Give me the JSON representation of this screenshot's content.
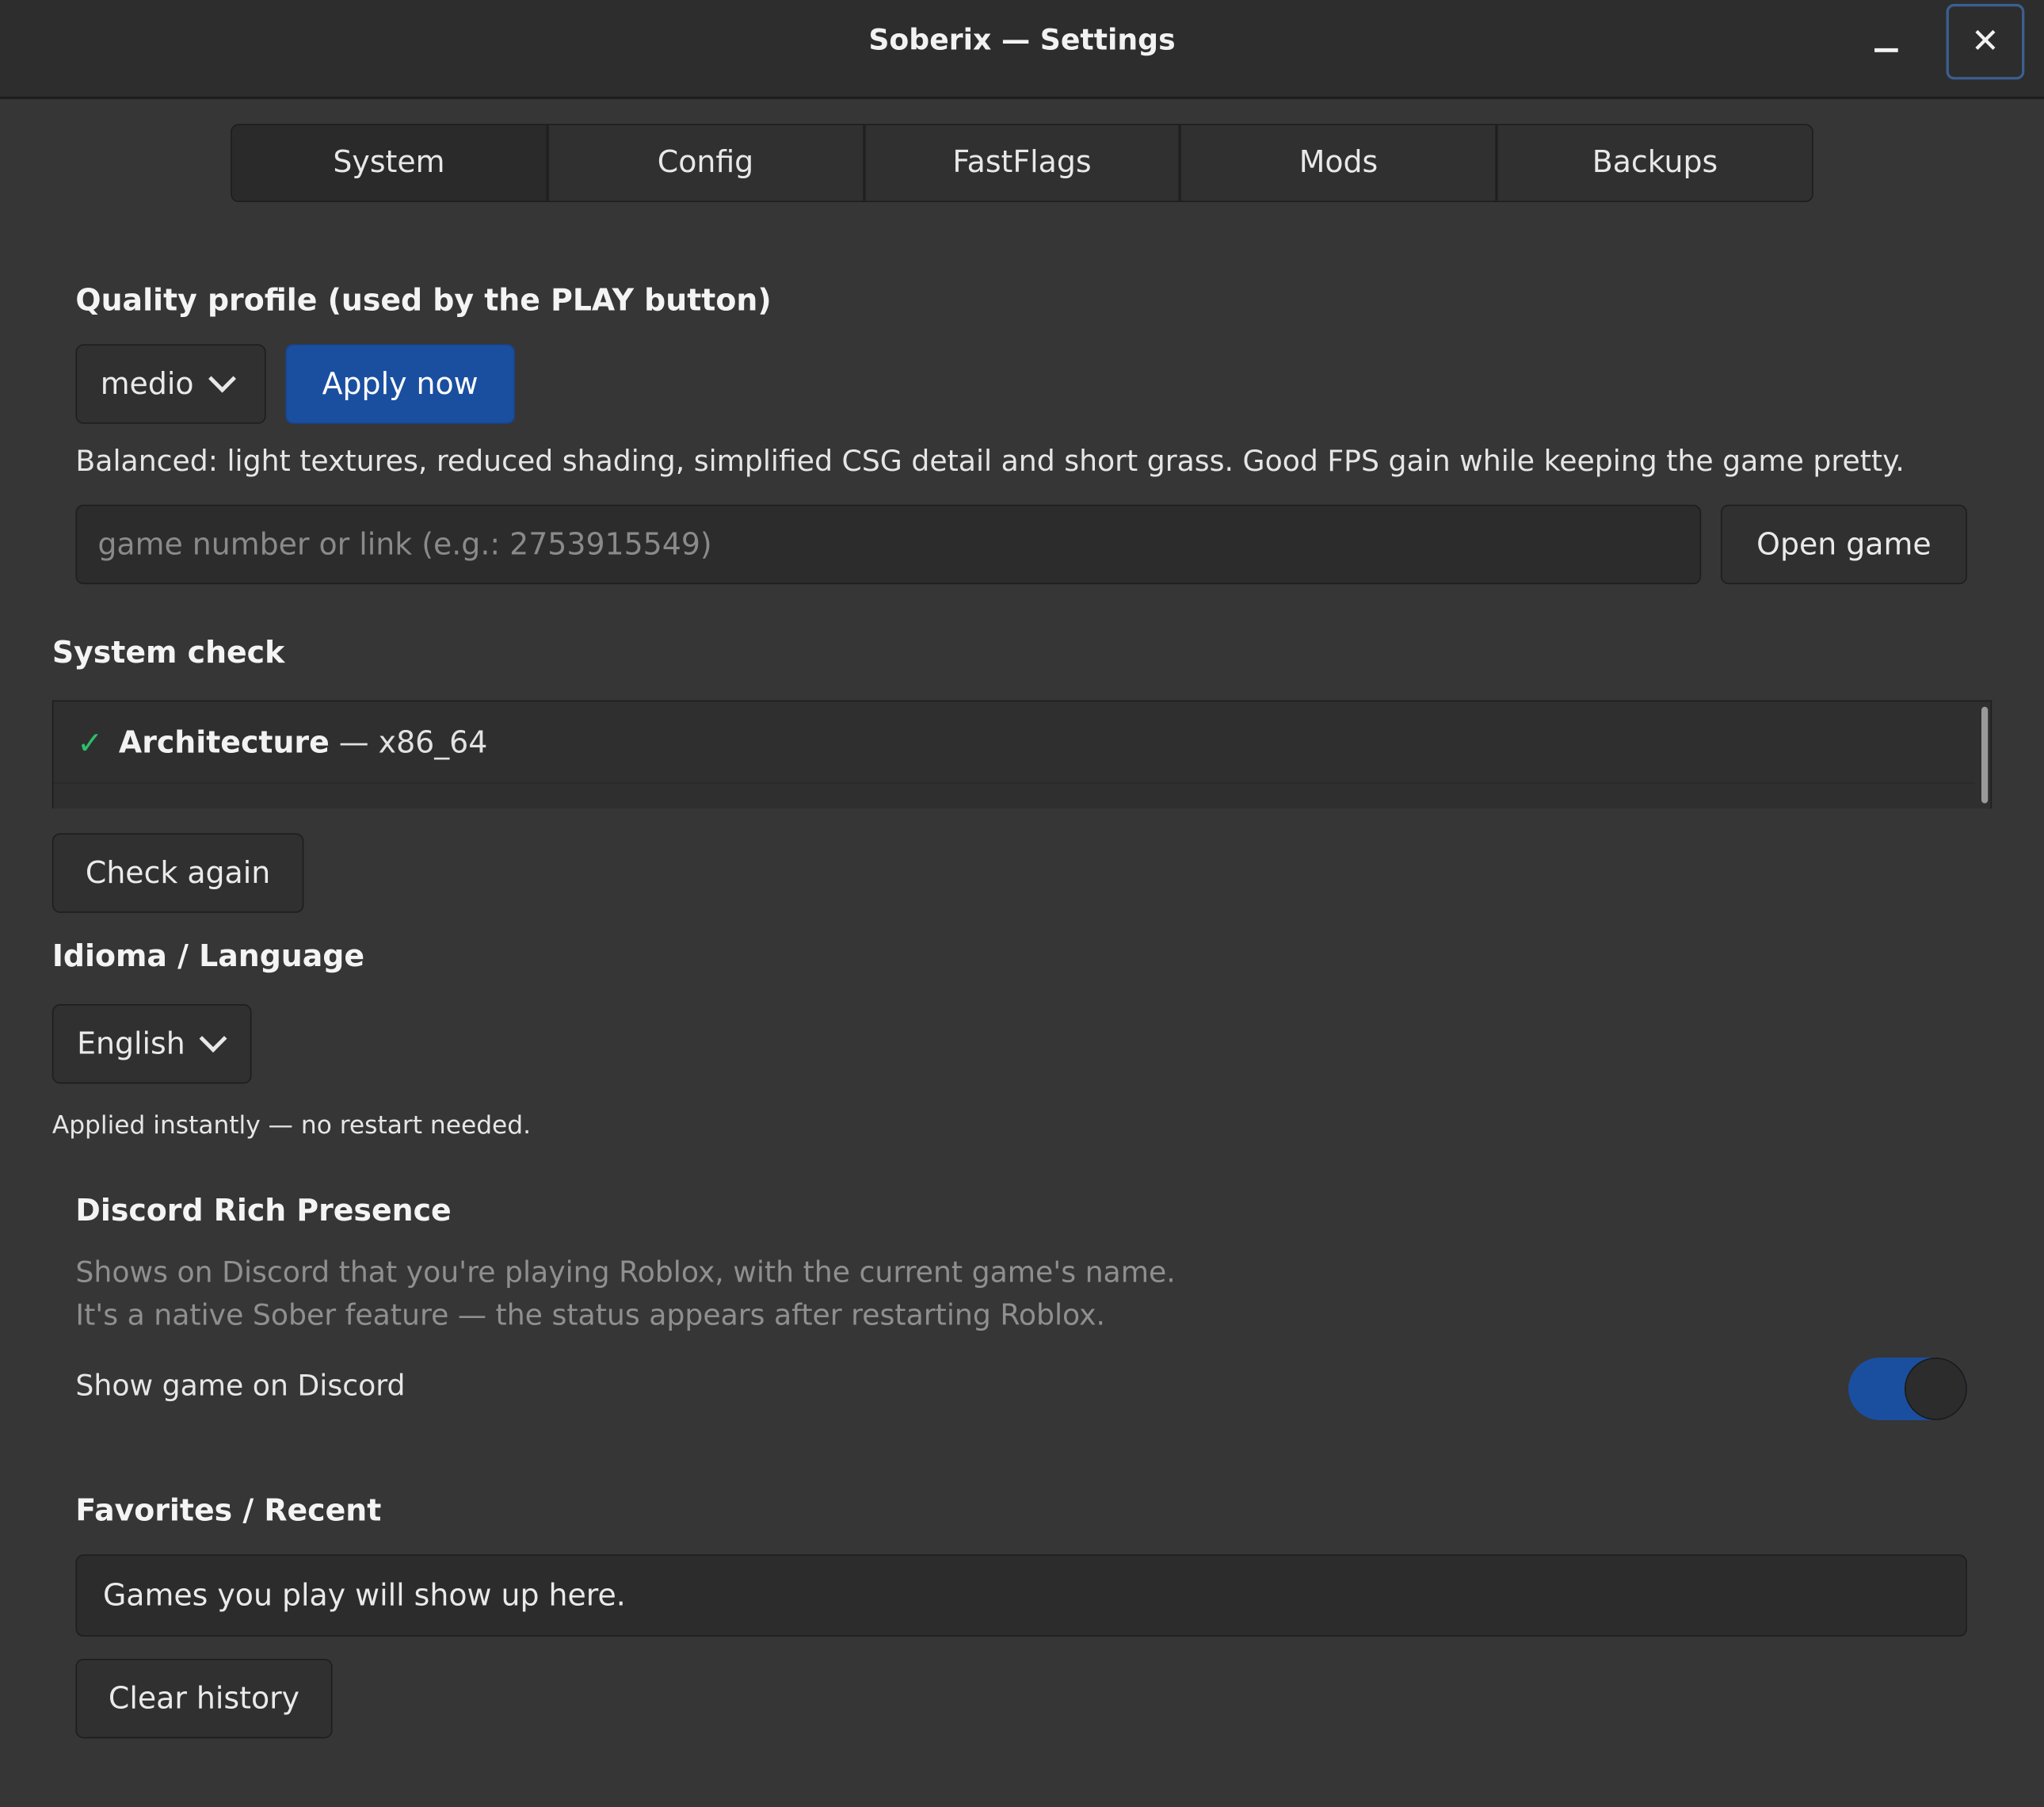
{
  "window": {
    "title": "Soberix — Settings",
    "minimize_icon": "minimize-icon",
    "close_icon": "close-icon",
    "close_glyph": "✕"
  },
  "tabs": [
    {
      "label": "System",
      "active": true
    },
    {
      "label": "Config",
      "active": false
    },
    {
      "label": "FastFlags",
      "active": false
    },
    {
      "label": "Mods",
      "active": false
    },
    {
      "label": "Backups",
      "active": false
    }
  ],
  "quality": {
    "heading": "Quality profile (used by the PLAY button)",
    "selected": "medio",
    "apply_label": "Apply now",
    "description": "Balanced: light textures, reduced shading, simplified CSG detail and short grass. Good FPS gain while keeping the game pretty.",
    "game_input_placeholder": "game number or link (e.g.: 2753915549)",
    "game_input_value": "",
    "open_game_label": "Open game"
  },
  "system_check": {
    "heading": "System check",
    "items": [
      {
        "status_icon": "check-icon",
        "glyph": "✓",
        "name": "Architecture",
        "separator": " — ",
        "value": "x86_64"
      }
    ],
    "check_again_label": "Check again"
  },
  "language": {
    "heading": "Idioma / Language",
    "selected": "English",
    "note": "Applied instantly — no restart needed."
  },
  "discord": {
    "heading": "Discord Rich Presence",
    "description_line1": "Shows on Discord that you're playing Roblox, with the current game's name.",
    "description_line2": "It's a native Sober feature — the status appears after restarting Roblox.",
    "toggle_label": "Show game on Discord",
    "toggle_on": true
  },
  "favorites": {
    "heading": "Favorites / Recent",
    "empty_text": "Games you play will show up here.",
    "clear_label": "Clear history"
  },
  "colors": {
    "background": "#363636",
    "titlebar": "#2d2d2d",
    "accent": "#1a4fa0",
    "check": "#2bbf6b"
  }
}
